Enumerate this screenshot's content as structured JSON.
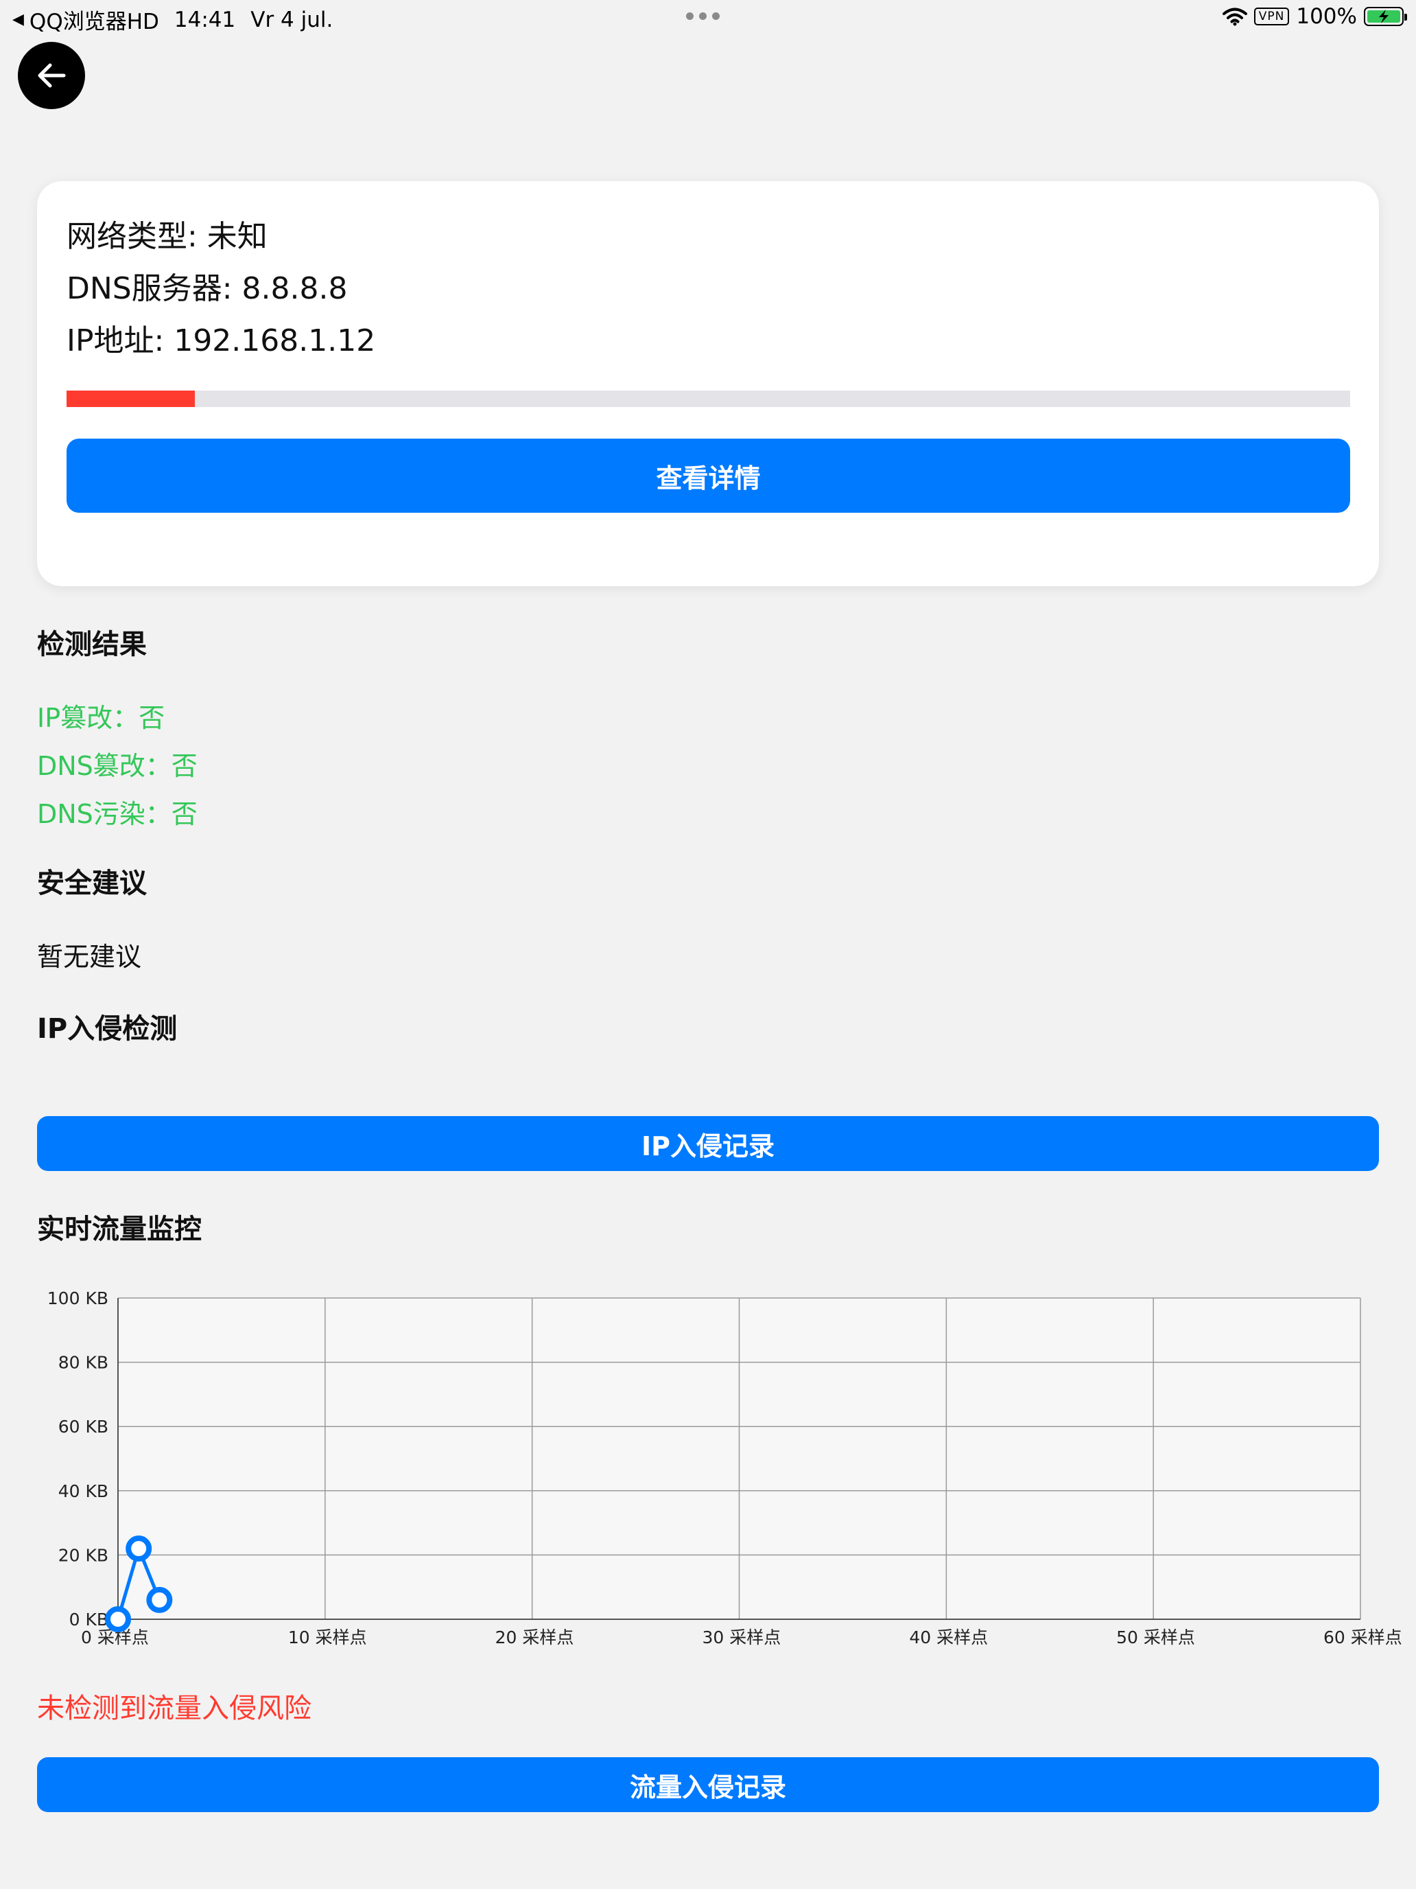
{
  "status_bar": {
    "app": "QQ浏览器HD",
    "time": "14:41",
    "date": "Vr 4 jul.",
    "vpn": "VPN",
    "battery": "100%"
  },
  "network_card": {
    "network_type": "网络类型: 未知",
    "dns_server": "DNS服务器: 8.8.8.8",
    "ip_address": "IP地址: 192.168.1.12",
    "risk_level_fraction": 0.1,
    "details_button": "查看详情"
  },
  "detection": {
    "title": "检测结果",
    "items": [
      "IP篡改：否",
      "DNS篡改：否",
      "DNS污染：否"
    ]
  },
  "advice": {
    "title": "安全建议",
    "text": "暂无建议"
  },
  "ip_intrusion": {
    "title": "IP入侵检测",
    "button": "IP入侵记录"
  },
  "traffic": {
    "title": "实时流量监控",
    "warning": "未检测到流量入侵风险",
    "button": "流量入侵记录"
  },
  "chart_data": {
    "type": "line",
    "title": "",
    "xlabel": "",
    "ylabel": "",
    "xlim": [
      0,
      60
    ],
    "ylim": [
      0,
      100
    ],
    "x_ticks": [
      0,
      10,
      20,
      30,
      40,
      50,
      60
    ],
    "x_tick_labels": [
      "0 采样点",
      "10 采样点",
      "20 采样点",
      "30 采样点",
      "40 采样点",
      "50 采样点",
      "60 采样点"
    ],
    "y_ticks": [
      0,
      20,
      40,
      60,
      80,
      100
    ],
    "y_tick_labels": [
      "0 KB",
      "20 KB",
      "40 KB",
      "60 KB",
      "80 KB",
      "100 KB"
    ],
    "grid": true,
    "series": [
      {
        "x": [
          0,
          1,
          2
        ],
        "y": [
          0,
          22,
          6
        ],
        "color": "#007aff"
      }
    ]
  }
}
